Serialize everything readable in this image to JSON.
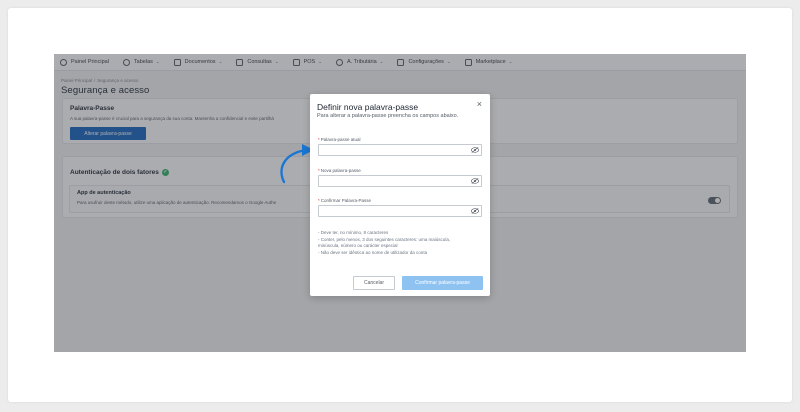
{
  "nav": {
    "items": [
      {
        "label": "Painel Principal",
        "icon": "dashboard-icon",
        "has_menu": false
      },
      {
        "label": "Tabelas",
        "icon": "tables-icon",
        "has_menu": true
      },
      {
        "label": "Documentos",
        "icon": "document-icon",
        "has_menu": true
      },
      {
        "label": "Consultas",
        "icon": "inquiry-icon",
        "has_menu": true
      },
      {
        "label": "POS",
        "icon": "pos-icon",
        "has_menu": true
      },
      {
        "label": "A. Tributária",
        "icon": "tax-icon",
        "has_menu": true
      },
      {
        "label": "Configurações",
        "icon": "settings-icon",
        "has_menu": true
      },
      {
        "label": "Marketplace",
        "icon": "marketplace-icon",
        "has_menu": true
      }
    ]
  },
  "breadcrumb": {
    "home": "Painel Principal",
    "separator": "/",
    "current": "Segurança e acesso"
  },
  "page": {
    "title": "Segurança e acesso"
  },
  "password_section": {
    "title": "Palavra-Passe",
    "text": "A sua palavra-passe é crucial para a segurança da sua conta. Mantenha a confidencial e evite partilhá",
    "button": "Alterar palavra-passe"
  },
  "twofa_section": {
    "title": "Autenticação de dois fatores",
    "app_title": "App de autenticação",
    "app_text": "Para usufruir deste método, utilize uma aplicação de autenticação. Recomendamos o Google Authe",
    "toggle_on": true
  },
  "modal": {
    "title": "Definir nova palavra-passe",
    "close": "×",
    "description": "Para alterar a palavra-passe preencha os campos abaixo.",
    "required_mark": "*",
    "fields": [
      {
        "label": "Palavra-passe atual",
        "value": ""
      },
      {
        "label": "Nova palavra-passe",
        "value": ""
      },
      {
        "label": "Confirmar Palavra-Passe",
        "value": ""
      }
    ],
    "rules": [
      "- Deve ter, no mínimo, 8 caracteres",
      "- Conter, pelo menos, 3 dos seguintes caracteres: uma maiúscula,",
      "minúscula, número ou carácter especial",
      "- Não deve ser idêntica ao nome de utilizador da conta"
    ],
    "cancel": "Cancelar",
    "confirm": "Confirmar palavra-passe"
  },
  "colors": {
    "primary": "#1565c0",
    "primary_disabled": "#8ec3f1",
    "success": "#2db36a",
    "annotation_arrow": "#1976d2",
    "overlay": "rgba(55,58,64,0.42)"
  }
}
